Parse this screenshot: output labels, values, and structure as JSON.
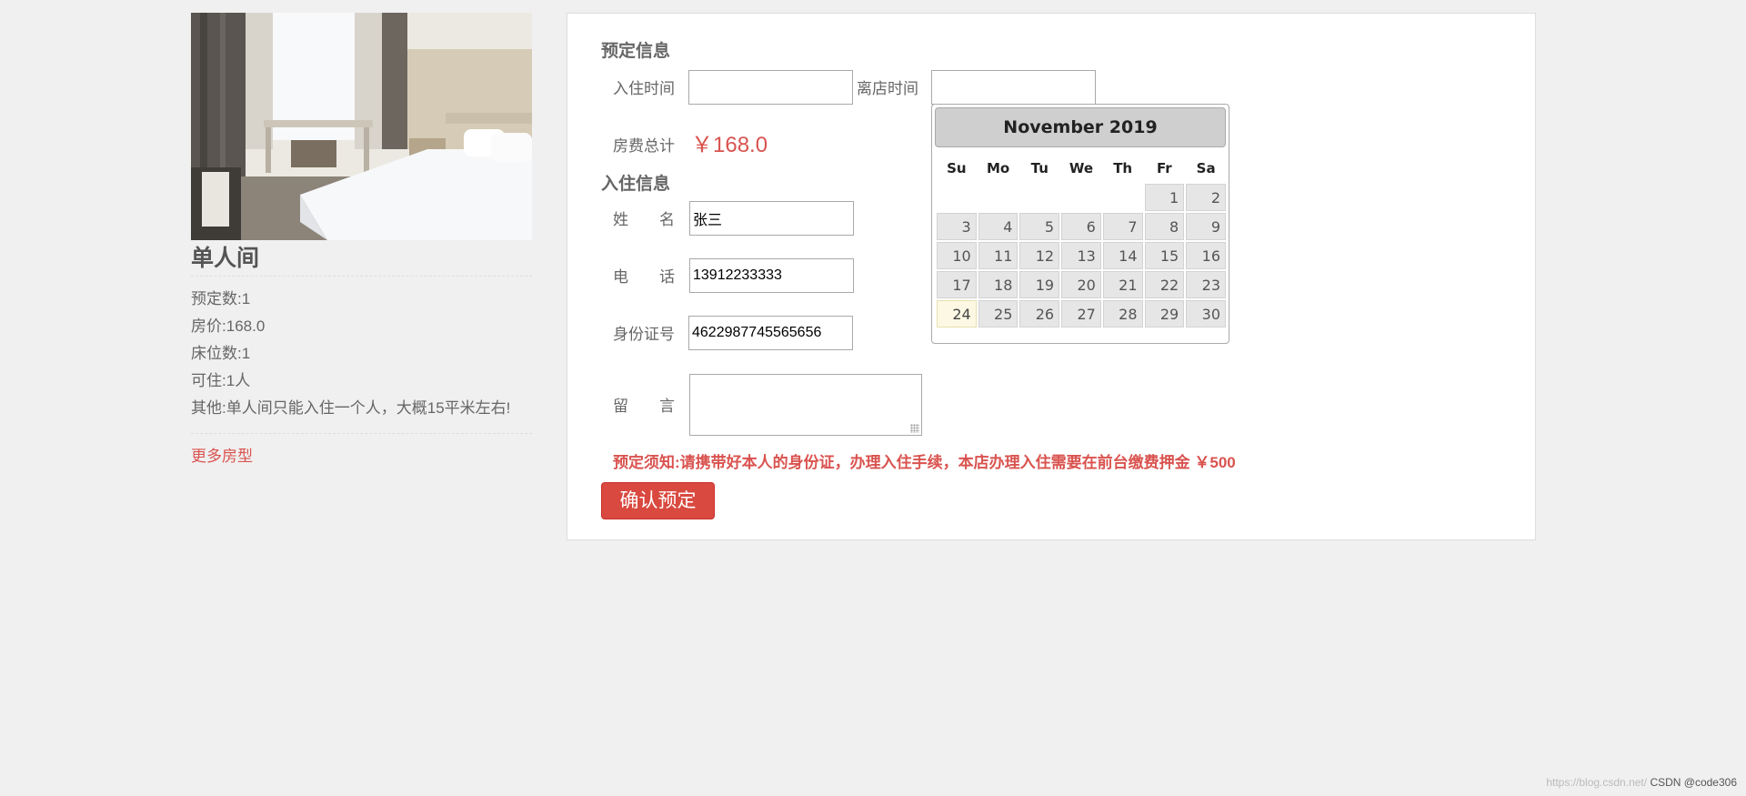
{
  "room": {
    "name": "单人间",
    "info": [
      {
        "label": "预定数:",
        "value": "1"
      },
      {
        "label": "房价:",
        "value": "168.0"
      },
      {
        "label": "床位数:",
        "value": "1"
      },
      {
        "label": "可住:",
        "value": "1人"
      },
      {
        "label": "其他:",
        "value": "单人间只能入住一个人，大概15平米左右!"
      }
    ],
    "more_link": "更多房型"
  },
  "booking": {
    "section_title": "预定信息",
    "checkin_label": "入住时间",
    "checkin_value": "",
    "checkout_label": "离店时间",
    "checkout_value": "",
    "total_label": "房费总计",
    "total_value": "￥168.0"
  },
  "guest": {
    "section_title": "入住信息",
    "name_label": "姓　　名",
    "name_value": "张三",
    "phone_label": "电　　话",
    "phone_value": "13912233333",
    "id_label": "身份证号",
    "id_value": "4622987745565656",
    "message_label": "留　　言",
    "message_value": ""
  },
  "notice": "预定须知:请携带好本人的身份证，办理入住手续，本店办理入住需要在前台缴费押金 ￥500",
  "confirm_button": "确认预定",
  "datepicker": {
    "month_title": "November 2019",
    "weekdays": [
      "Su",
      "Mo",
      "Tu",
      "We",
      "Th",
      "Fr",
      "Sa"
    ],
    "weeks": [
      [
        "",
        "",
        "",
        "",
        "",
        "1",
        "2"
      ],
      [
        "3",
        "4",
        "5",
        "6",
        "7",
        "8",
        "9"
      ],
      [
        "10",
        "11",
        "12",
        "13",
        "14",
        "15",
        "16"
      ],
      [
        "17",
        "18",
        "19",
        "20",
        "21",
        "22",
        "23"
      ],
      [
        "24",
        "25",
        "26",
        "27",
        "28",
        "29",
        "30"
      ]
    ],
    "today": "24"
  },
  "watermark": {
    "url": "https://blog.csdn.net/",
    "author": "CSDN @code306"
  },
  "colors": {
    "accent_red": "#d9534f",
    "panel_bg": "#ffffff",
    "page_bg": "#f0f0f0"
  }
}
